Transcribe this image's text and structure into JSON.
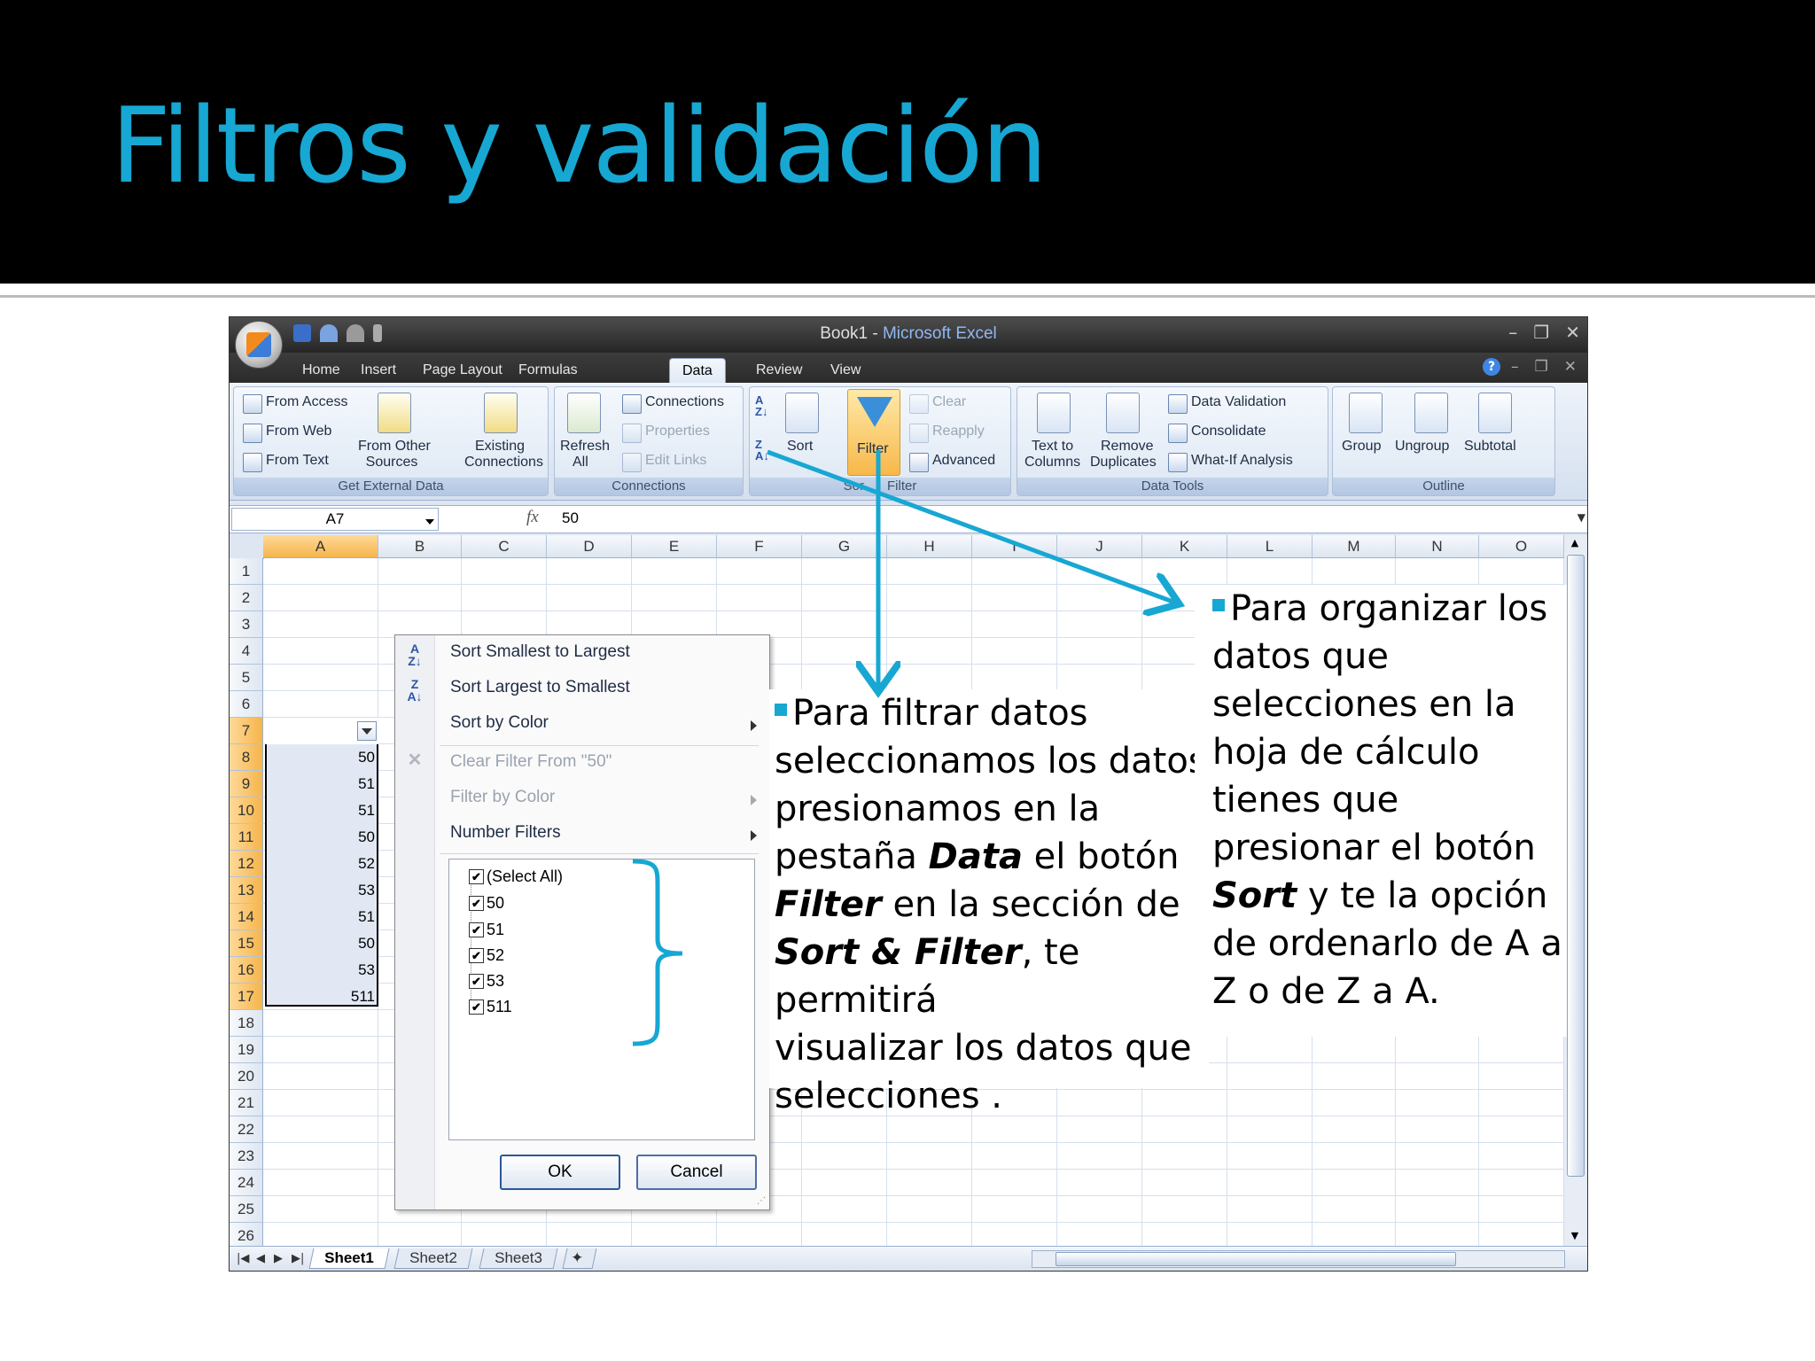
{
  "slide": {
    "title": "Filtros y validación",
    "accent_color": "#17a7d3",
    "background_top": "#000000"
  },
  "excel": {
    "window_title_doc": "Book1",
    "window_title_sep": " - ",
    "window_title_app": "Microsoft Excel",
    "tabs": [
      "Home",
      "Insert",
      "Page Layout",
      "Formulas",
      "Data",
      "Review",
      "View"
    ],
    "active_tab": "Data",
    "ribbon": {
      "get_external": {
        "from_access": "From Access",
        "from_web": "From Web",
        "from_text": "From Text",
        "from_other_1": "From Other",
        "from_other_2": "Sources",
        "existing_1": "Existing",
        "existing_2": "Connections",
        "label": "Get External Data"
      },
      "connections": {
        "refresh_1": "Refresh",
        "refresh_2": "All",
        "connections": "Connections",
        "properties": "Properties",
        "edit_links": "Edit Links",
        "label": "Connections"
      },
      "sort_filter": {
        "sort": "Sort",
        "filter": "Filter",
        "clear": "Clear",
        "reapply": "Reapply",
        "advanced": "Advanced",
        "label_left": "Sor",
        "label_right": "Filter"
      },
      "data_tools": {
        "text_to_1": "Text to",
        "text_to_2": "Columns",
        "remove_1": "Remove",
        "remove_2": "Duplicates",
        "data_validation": "Data Validation",
        "consolidate": "Consolidate",
        "what_if": "What-If Analysis",
        "label": "Data Tools"
      },
      "outline": {
        "group": "Group",
        "ungroup": "Ungroup",
        "subtotal": "Subtotal",
        "label": "Outline"
      }
    },
    "formula_bar": {
      "name_box": "A7",
      "fx": "fx",
      "value": "50"
    },
    "columns": [
      "A",
      "B",
      "C",
      "D",
      "E",
      "F",
      "G",
      "H",
      "I",
      "J",
      "K",
      "L",
      "M",
      "N",
      "O"
    ],
    "rows": [
      "1",
      "2",
      "3",
      "4",
      "5",
      "6",
      "7",
      "8",
      "9",
      "10",
      "11",
      "12",
      "13",
      "14",
      "15",
      "16",
      "17",
      "18",
      "19",
      "20",
      "21",
      "22",
      "23",
      "24",
      "25",
      "26"
    ],
    "cells_a": [
      {
        "row": "8",
        "value": "50"
      },
      {
        "row": "9",
        "value": "51"
      },
      {
        "row": "10",
        "value": "51"
      },
      {
        "row": "11",
        "value": "50"
      },
      {
        "row": "12",
        "value": "52"
      },
      {
        "row": "13",
        "value": "53"
      },
      {
        "row": "14",
        "value": "51"
      },
      {
        "row": "15",
        "value": "50"
      },
      {
        "row": "16",
        "value": "53"
      },
      {
        "row": "17",
        "value": "511"
      }
    ],
    "sheets": [
      "Sheet1",
      "Sheet2",
      "Sheet3"
    ],
    "active_sheet": "Sheet1"
  },
  "filter_menu": {
    "sort_asc": "Sort Smallest to Largest",
    "sort_desc": "Sort Largest to Smallest",
    "sort_color": "Sort by Color",
    "clear_filter": "Clear Filter From \"50\"",
    "filter_color": "Filter by Color",
    "number_filters": "Number Filters",
    "checklist": [
      "(Select All)",
      "50",
      "51",
      "52",
      "53",
      "511"
    ],
    "ok": "OK",
    "cancel": "Cancel"
  },
  "notes": {
    "left": {
      "l1": "Para filtrar datos",
      "l2": "seleccionamos los datos",
      "l3": "presionamos en la",
      "l4a": "pestaña ",
      "l4b": "Data",
      "l4c": " el botón",
      "l5a": "Filter",
      "l5b": " en la sección de",
      "l6a": "Sort & Filter",
      "l6b": ", te permitirá",
      "l7": "visualizar los datos que",
      "l8": "selecciones ."
    },
    "right": {
      "l1": "Para organizar los",
      "l2": "datos que",
      "l3": "selecciones en la",
      "l4": "hoja de cálculo",
      "l5": "tienes que",
      "l6": "presionar el botón",
      "l7a": "Sort",
      "l7b": " y te la opción",
      "l8": "de ordenarlo de A a",
      "l9": "Z o de Z a A."
    }
  }
}
